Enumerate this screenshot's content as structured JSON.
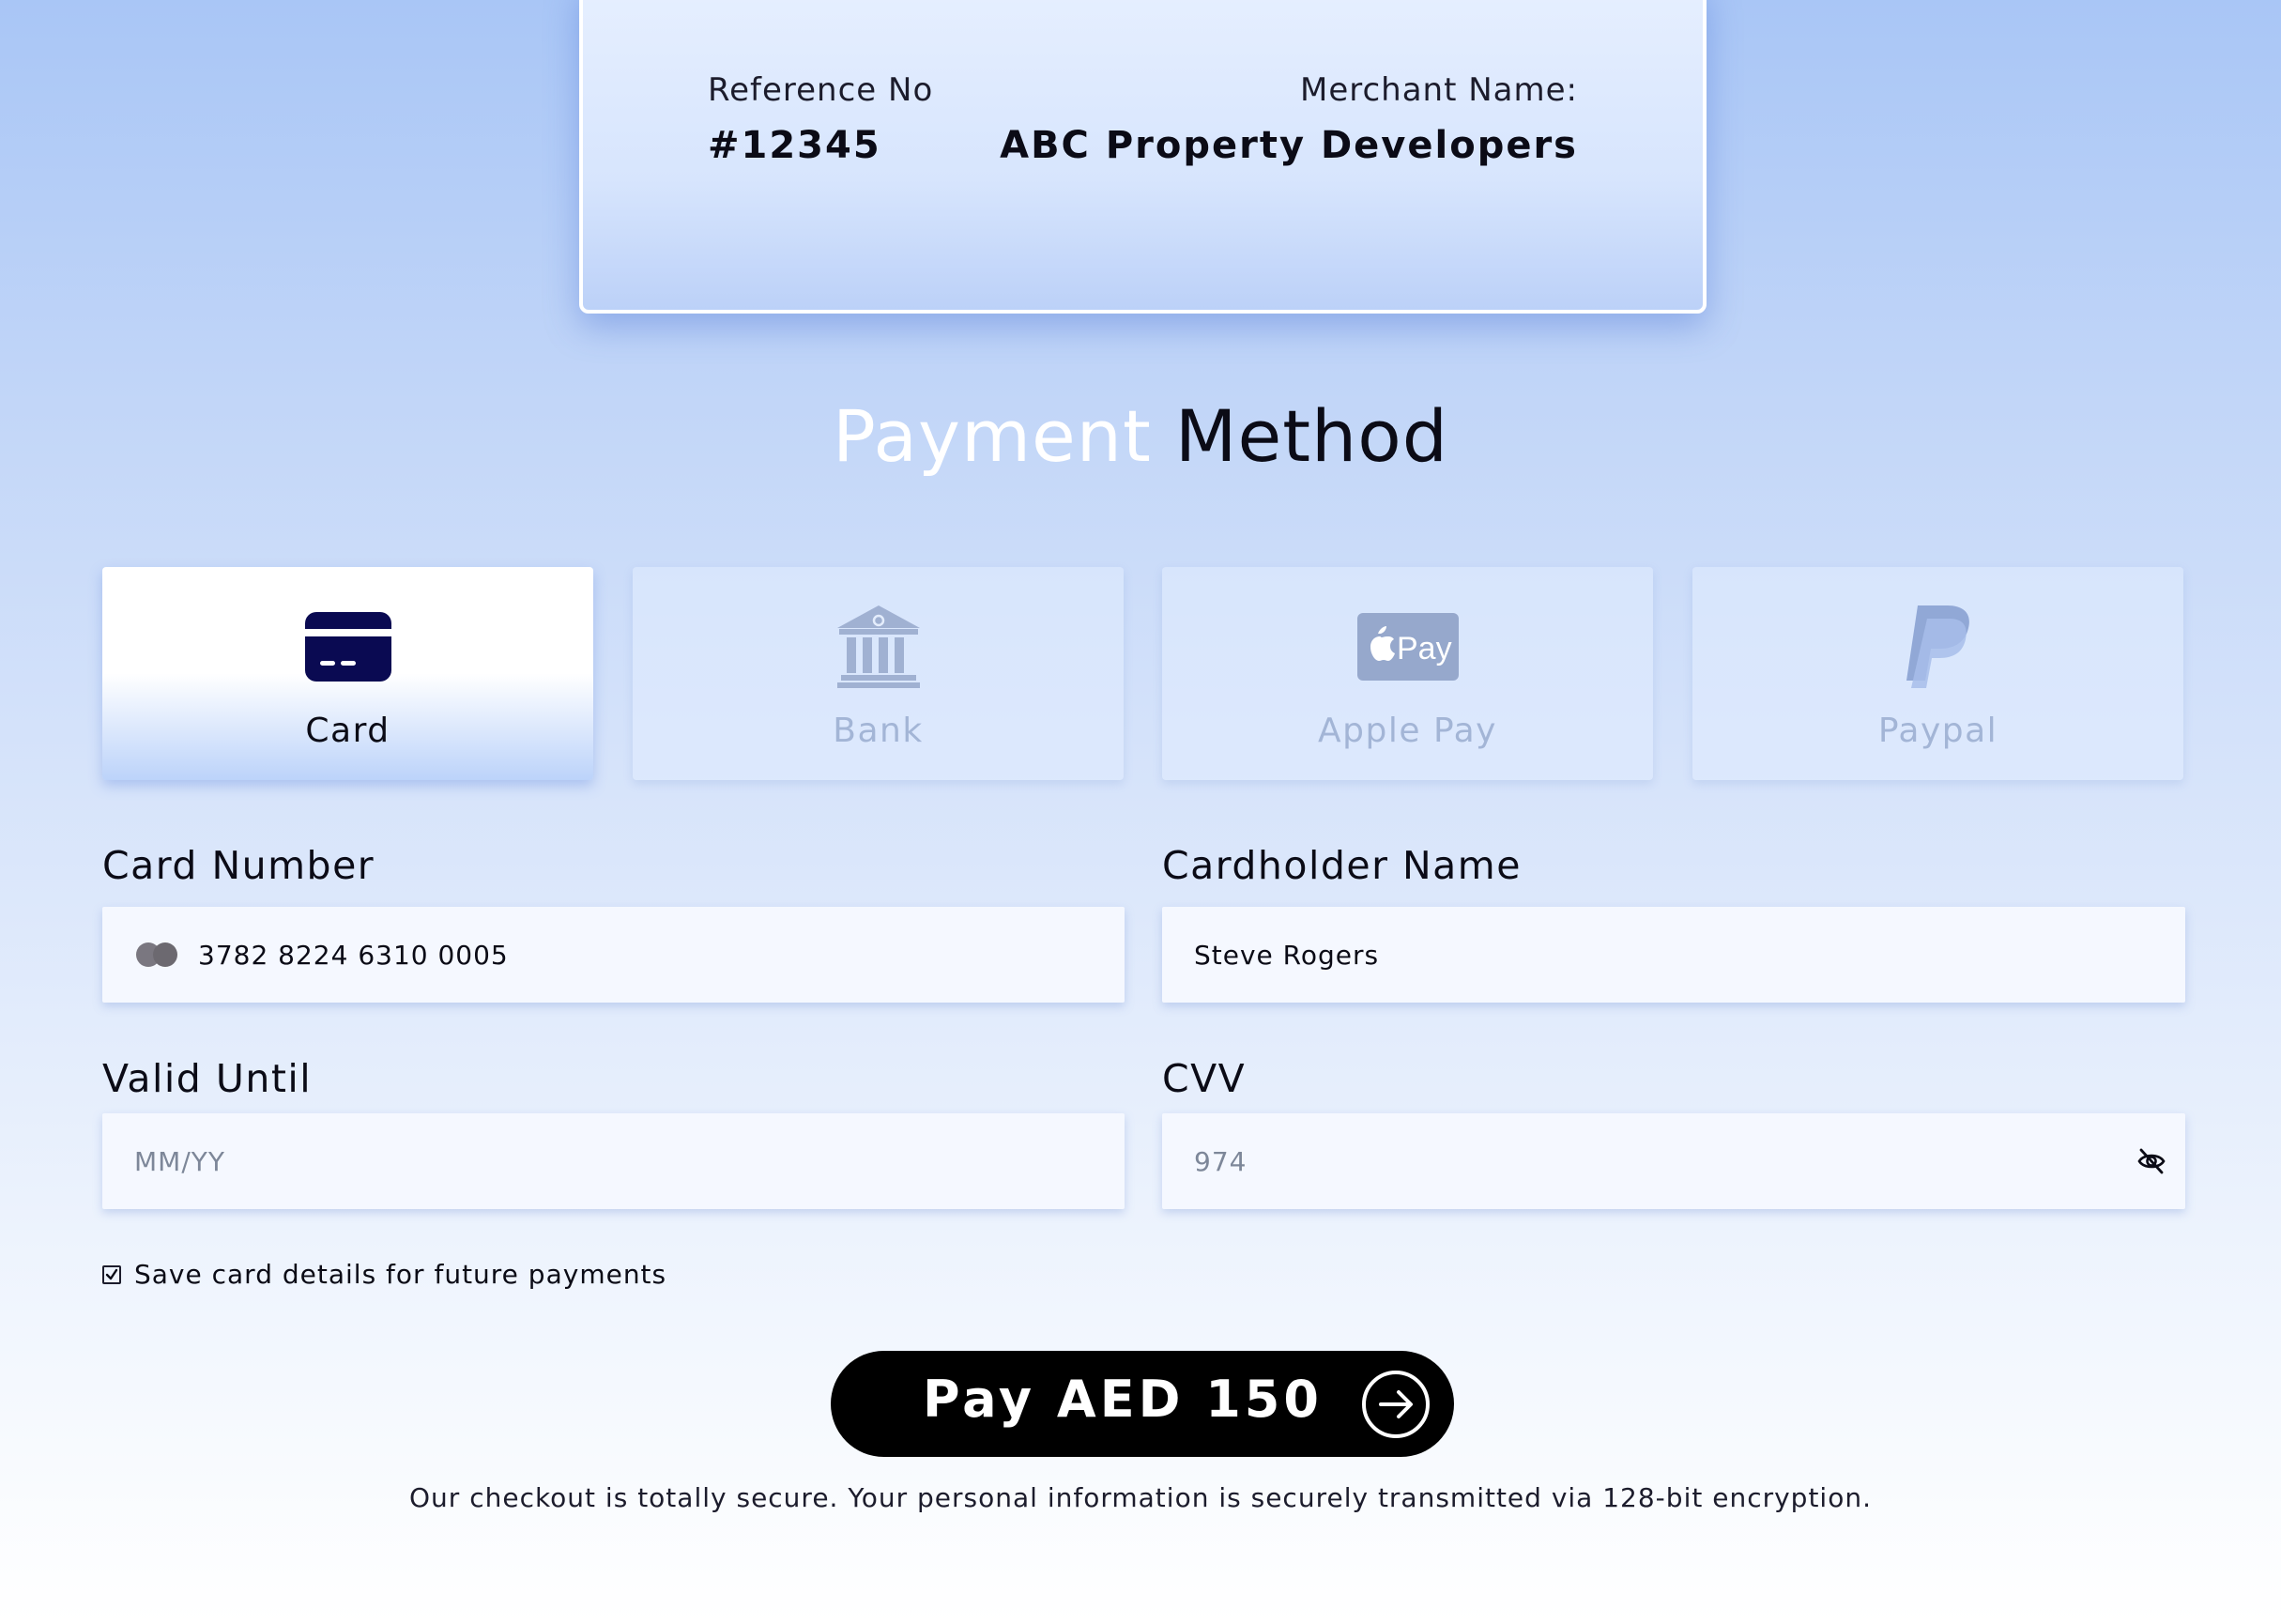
{
  "merchant": {
    "reference_label": "Reference No",
    "reference_value": "#12345",
    "merchant_label": "Merchant Name:",
    "merchant_value": "ABC Property Developers"
  },
  "title": {
    "light": "Payment",
    "dark": "Method"
  },
  "payment_methods": [
    {
      "label": "Card",
      "icon": "credit-card-icon",
      "selected": true
    },
    {
      "label": "Bank",
      "icon": "bank-icon",
      "selected": false
    },
    {
      "label": "Apple Pay",
      "icon": "apple-pay-icon",
      "selected": false
    },
    {
      "label": "Paypal",
      "icon": "paypal-icon",
      "selected": false
    }
  ],
  "form": {
    "card_number": {
      "label": "Card Number",
      "value": "3782 8224 6310 0005",
      "brand_icon": "card-brand-icon"
    },
    "cardholder": {
      "label": "Cardholder Name",
      "value": "Steve Rogers"
    },
    "valid_until": {
      "label": "Valid Until",
      "placeholder": "MM/YY"
    },
    "cvv": {
      "label": "CVV",
      "value": "974",
      "toggle_icon": "eye-off-icon"
    },
    "save_card": {
      "label": "Save card details for future payments",
      "checked": true
    }
  },
  "pay_button": {
    "label": "Pay AED 150",
    "icon": "arrow-right-circle-icon"
  },
  "secure_note": "Our checkout is totally secure. Your personal information is securely transmitted via 128-bit encryption.",
  "colors": {
    "accent_dark": "#0b0b16",
    "card_icon": "#0a0a52",
    "inactive_icon": "#a3b5d6",
    "background_top": "#a9c6f6",
    "background_bottom": "#ffffff"
  }
}
